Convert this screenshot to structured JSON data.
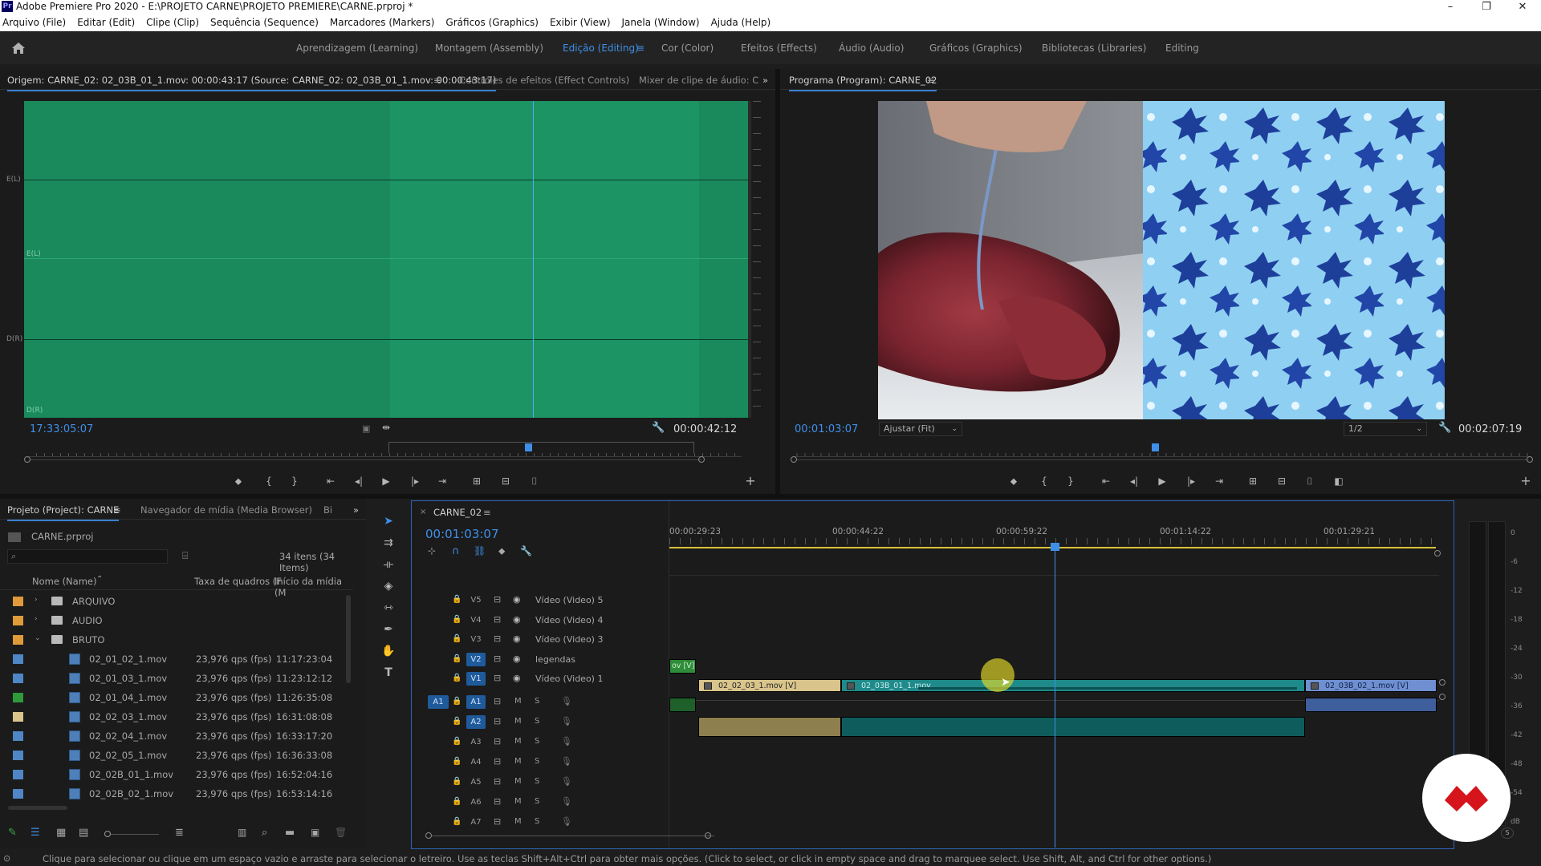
{
  "window": {
    "title": "Adobe Premiere Pro 2020 - E:\\PROJETO CARNE\\PROJETO PREMIERE\\CARNE.prproj *",
    "logo_text": "Pr",
    "controls": [
      "minimize-button",
      "restore-button",
      "close-button"
    ]
  },
  "menu": [
    "Arquivo (File)",
    "Editar (Edit)",
    "Clipe (Clip)",
    "Sequência (Sequence)",
    "Marcadores (Markers)",
    "Gráficos (Graphics)",
    "Exibir (View)",
    "Janela (Window)",
    "Ajuda (Help)"
  ],
  "workspaces": {
    "learning": "Aprendizagem (Learning)",
    "assembly": "Montagem (Assembly)",
    "editing": "Edição (Editing)",
    "color": "Cor (Color)",
    "effects": "Efeitos (Effects)",
    "audio": "Áudio (Audio)",
    "graphics": "Gráficos (Graphics)",
    "libraries": "Bibliotecas (Libraries)",
    "editing2": "Editing",
    "active": "editing"
  },
  "source_panel": {
    "tab_source": "Origem: CARNE_02: 02_03B_01_1.mov: 00:00:43:17 (Source: CARNE_02: 02_03B_01_1.mov: 00:00:43:17)",
    "tab_effect_controls": "Controles de efeitos (Effect Controls)",
    "tab_audio_mixer": "Mixer de clipe de áudio: C",
    "channel_labels": [
      "E(L)",
      "E(L)",
      "D(R)",
      "D(R)"
    ],
    "timecode_current": "17:33:05:07",
    "timecode_duration": "00:00:42:12"
  },
  "program_panel": {
    "tab": "Programa (Program): CARNE_02",
    "timecode_current": "00:01:03:07",
    "fit_label": "Ajustar (Fit)",
    "resolution": "1/2",
    "timecode_duration": "00:02:07:19"
  },
  "project_panel": {
    "tab_project": "Projeto (Project): CARNE",
    "tab_media_browser": "Navegador de mídia (Media Browser)",
    "tab_extra": "Bi",
    "project_file": "CARNE.prproj",
    "item_count": "34 itens (34 Items)",
    "search_placeholder": "",
    "columns": {
      "name": "Nome (Name)",
      "fps": "Taxa de quadros (F",
      "start": "Início da mídia (M"
    },
    "items": [
      {
        "type": "folder",
        "name": "ARQUIVO",
        "color": "#e09a3a",
        "expanded": false,
        "fps": "",
        "start": ""
      },
      {
        "type": "folder",
        "name": "AUDIO",
        "color": "#e09a3a",
        "expanded": false,
        "fps": "",
        "start": ""
      },
      {
        "type": "folder",
        "name": "BRUTO",
        "color": "#e09a3a",
        "expanded": true,
        "fps": "",
        "start": ""
      },
      {
        "type": "clip",
        "name": "02_01_02_1.mov",
        "color": "#4f86c6",
        "fps": "23,976 qps (fps)",
        "start": "11:17:23:04"
      },
      {
        "type": "clip",
        "name": "02_01_03_1.mov",
        "color": "#4f86c6",
        "fps": "23,976 qps (fps)",
        "start": "11:23:12:12"
      },
      {
        "type": "clip",
        "name": "02_01_04_1.mov",
        "color": "#2e9a3a",
        "fps": "23,976 qps (fps)",
        "start": "11:26:35:08"
      },
      {
        "type": "clip",
        "name": "02_02_03_1.mov",
        "color": "#d9c58c",
        "fps": "23,976 qps (fps)",
        "start": "16:31:08:08"
      },
      {
        "type": "clip",
        "name": "02_02_04_1.mov",
        "color": "#4f86c6",
        "fps": "23,976 qps (fps)",
        "start": "16:33:17:20"
      },
      {
        "type": "clip",
        "name": "02_02_05_1.mov",
        "color": "#4f86c6",
        "fps": "23,976 qps (fps)",
        "start": "16:36:33:08"
      },
      {
        "type": "clip",
        "name": "02_02B_01_1.mov",
        "color": "#4f86c6",
        "fps": "23,976 qps (fps)",
        "start": "16:52:04:16"
      },
      {
        "type": "clip",
        "name": "02_02B_02_1.mov",
        "color": "#4f86c6",
        "fps": "23,976 qps (fps)",
        "start": "16:53:14:16"
      }
    ]
  },
  "timeline": {
    "tab": "CARNE_02",
    "timecode": "00:01:03:07",
    "ruler_labels": [
      "00:00:29:23",
      "00:00:44:22",
      "00:00:59:22",
      "00:01:14:22",
      "00:01:29:21"
    ],
    "video_tracks": [
      {
        "id": "V5",
        "name": "Vídeo (Video) 5"
      },
      {
        "id": "V4",
        "name": "Vídeo (Video) 4"
      },
      {
        "id": "V3",
        "name": "Vídeo (Video) 3"
      },
      {
        "id": "V2",
        "name": "legendas"
      },
      {
        "id": "V1",
        "name": "Vídeo (Video) 1"
      }
    ],
    "audio_tracks": [
      {
        "id": "A1",
        "source": "A1"
      },
      {
        "id": "A2"
      },
      {
        "id": "A3"
      },
      {
        "id": "A4"
      },
      {
        "id": "A5"
      },
      {
        "id": "A6"
      },
      {
        "id": "A7"
      }
    ],
    "mute_label": "M",
    "solo_label": "S",
    "clips": {
      "v2_clip": "ov [V]",
      "v1_clip_a": "02_02_03_1.mov [V]",
      "v1_clip_b": "02_03B_01_1.mov",
      "v1_clip_c": "02_03B_02_1.mov [V]"
    }
  },
  "meter": {
    "labels": [
      "0",
      "-6",
      "-12",
      "-18",
      "-24",
      "-30",
      "-36",
      "-42",
      "-48",
      "-54",
      "dB"
    ],
    "solo": "S"
  },
  "status_bar": "Clique para selecionar ou clique em um espaço vazio e arraste para selecionar o letreiro. Use as teclas Shift+Alt+Ctrl para obter mais opções. (Click to select, or click in empty space and drag to marquee select. Use Shift, Alt, and Ctrl for other options.)",
  "colors": {
    "accent": "#3f8fe8",
    "waveform": "#1a8a5c",
    "clip_tan": "#d9c58c",
    "clip_teal": "#1f8a8a",
    "clip_blue": "#6f8fd0",
    "badge_red": "#d5141c"
  }
}
